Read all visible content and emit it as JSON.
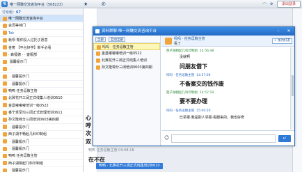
{
  "app": {
    "title": "唯一网赚交流咨询平台（508223）",
    "exit_label": "退出登录",
    "left_header_prefix": "讨论组：",
    "left_header_count": "67"
  },
  "left_list": [
    {
      "text": "唯一网赚交流咨询平台"
    },
    {
      "text": "会员等待门"
    },
    {
      "text": "Tok"
    },
    {
      "text": "耗呗  帮你投入过托子愿意"
    },
    {
      "text": "金奢  【平台好学】新手必看"
    },
    {
      "text": "· 森福德 ·        · 客服部"
    },
    {
      "text": "   温馨提示门"
    },
    {
      "text": "            ·"
    },
    {
      "text": "        · 温馨提示门"
    },
    {
      "text": "        · 温馨提示门"
    },
    {
      "text": "鸭鸭   任务逗散主管"
    },
    {
      "text": "北冀花开三阔正式线集人培训0610"
    },
    {
      "text": "金曼嘟嘟嘟培训一级0522"
    },
    {
      "text": "番宁季至均三阔正式管理培训0611"
    },
    {
      "text": "孙文隆棉分三阔培训0603第四期"
    },
    {
      "text": "        · 温馨提示门"
    },
    {
      "text": "西子湖不畅起几科印制组"
    },
    {
      "text": "        · 温馨提示门"
    },
    {
      "text": "        · 温馨提示门"
    },
    {
      "text": "鸭鸭   任务逗散主管"
    },
    {
      "text": "西子湖相起几科印制组"
    },
    {
      "text": "        · 温馨提示门"
    }
  ],
  "background_chat": {
    "big_chars": [
      "心",
      "哼",
      "次",
      "双"
    ],
    "bottom_meta": "鸭鸭  任务逗散主管    09:08:18",
    "bottom_bold": "在不在",
    "bottom_pill": "鸭鸭 · 北冀花开三阔正式线集培训0610 ·"
  },
  "dialog": {
    "title": "资料群聊-唯一网赚交流咨询平台",
    "tabs": [
      "全部",
      "互动全部"
    ],
    "list": [
      {
        "text": "吗吗 · 任务逗散主管",
        "selected": true
      },
      {
        "text": "金曼嘟嘟嘟培训一级0522",
        "selected": false
      },
      {
        "text": "北冀花开三阔正式线集人培训",
        "selected": false
      },
      {
        "text": "孙文隆棉分三阔培训0603第四期",
        "selected": false
      }
    ],
    "conv_name": "吗吗 · 任务逗散主管",
    "conv_sub": "看了",
    "add_label": "+ 加为好友",
    "messages": [
      {
        "sender": "西子湖相起几科印制组",
        "time": "14:56:48",
        "text": "没就啊",
        "big": false,
        "color": "green"
      },
      {
        "sender": "",
        "time": "",
        "text": "问朋友借下",
        "big": true,
        "color": ""
      },
      {
        "sender": "吗吗 · 任务逗散主管",
        "time": "14:57:00",
        "text": "不备案交的钱作废",
        "big": true,
        "color": "blue"
      },
      {
        "sender": "西子湖相起几科印制组",
        "time": "14:57:19",
        "text": "要不要办理",
        "big": true,
        "color": "green"
      },
      {
        "sender": "吗吗 · 任务逗散主管",
        "time": "15:00:20",
        "text": "已举报·我是别人举报·看服来的，我也好奇",
        "big": false,
        "color": "blue"
      }
    ],
    "emoji_icon": "smile-icon",
    "send_label": "↵"
  },
  "colors": {
    "titlebar": "#2369c4",
    "accent": "#2f79d8",
    "name_green": "#2e8b3e",
    "name_blue": "#2a68c8",
    "avatar": "#f0a43a"
  }
}
